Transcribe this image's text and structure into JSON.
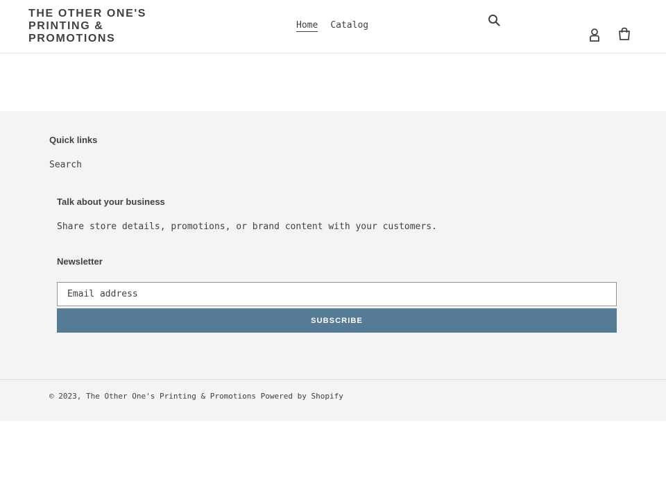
{
  "header": {
    "logo": "THE OTHER ONE'S PRINTING & PROMOTIONS",
    "nav": [
      {
        "label": "Home"
      },
      {
        "label": "Catalog"
      }
    ],
    "icons": {
      "search": "search-icon",
      "account": "user-icon",
      "cart": "cart-icon"
    }
  },
  "footer": {
    "quick_links": {
      "heading": "Quick links",
      "links": [
        {
          "label": "Search"
        }
      ]
    },
    "business": {
      "heading": "Talk about your business",
      "text": "Share store details, promotions, or brand content with your customers."
    },
    "newsletter": {
      "heading": "Newsletter",
      "email_placeholder": "Email address",
      "email_value": "",
      "subscribe_label": "SUBSCRIBE"
    },
    "copyright": {
      "prefix": "© 2023,",
      "store_name": "The Other One's Printing & Promotions",
      "powered": "Powered by Shopify"
    }
  },
  "colors": {
    "text": "#3d4246",
    "button": "#557b97",
    "footer_bg": "#f4f4f4"
  }
}
